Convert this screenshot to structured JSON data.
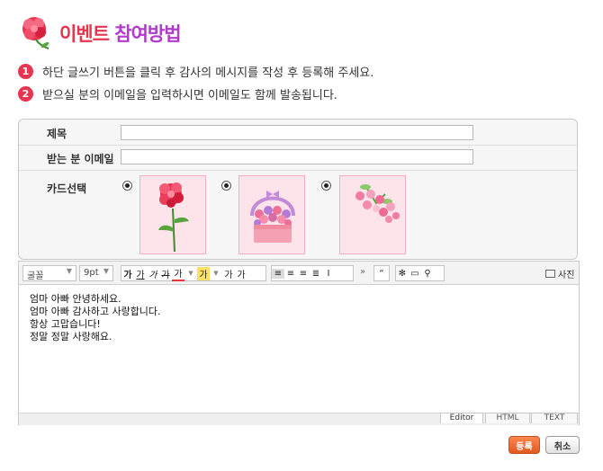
{
  "title": {
    "part1": "이벤트",
    "part2": "참여방법"
  },
  "steps": [
    {
      "num": "1",
      "text": "하단 글쓰기 버튼을 클릭 후 감사의 메시지를 작성 후 등록해 주세요."
    },
    {
      "num": "2",
      "text": "받으실 분의 이메일을 입력하시면 이메일도 함께 발송됩니다."
    }
  ],
  "form": {
    "subject_label": "제목",
    "subject_value": "",
    "email_label": "받는 분 이메일",
    "email_value": "",
    "card_label": "카드선택",
    "cards": [
      {
        "name": "carnation",
        "selected": true
      },
      {
        "name": "flower-basket",
        "selected": true
      },
      {
        "name": "bouquet",
        "selected": true
      }
    ]
  },
  "toolbar": {
    "font_family": "굴꼴",
    "font_size": "9pt",
    "bold": "가",
    "underline": "가",
    "italic": "가",
    "strike": "가",
    "text_color": "가",
    "bg_color": "가",
    "superscript": "가",
    "subscript": "가",
    "more": "»",
    "quote": "“",
    "photo_label": "사진"
  },
  "editor": {
    "lines": [
      "엄마 아빠 안녕하세요.",
      "엄마 아빠 감사하고 사랑합니다.",
      "항상 고맙습니다!",
      "정말 정말 사랑해요."
    ],
    "modes": [
      "Editor",
      "HTML",
      "TEXT"
    ]
  },
  "buttons": {
    "submit": "등록",
    "cancel": "취소"
  },
  "colors": {
    "accent_red": "#e8344f",
    "accent_purple": "#b03acb",
    "submit_orange": "#f06a2a"
  }
}
